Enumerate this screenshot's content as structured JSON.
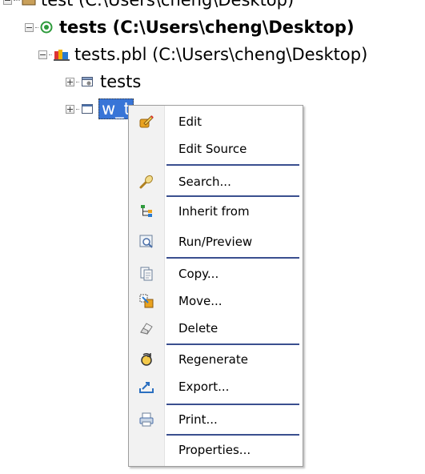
{
  "tree": {
    "workspace_label": "test (C:\\Users\\cheng\\Desktop)",
    "target_label": "tests (C:\\Users\\cheng\\Desktop)",
    "library_label": "tests.pbl (C:\\Users\\cheng\\Desktop)",
    "app_object_label": "tests",
    "window_object_label": "w_t"
  },
  "context_menu": {
    "items": [
      {
        "label": "Edit",
        "icon": "edit-pencil-icon"
      },
      {
        "label": "Edit Source",
        "icon": ""
      },
      {
        "label": "Search...",
        "icon": "search-icon"
      },
      {
        "label": "Inherit from",
        "icon": "inherit-tree-icon"
      },
      {
        "label": "Run/Preview",
        "icon": "run-preview-icon"
      },
      {
        "label": "Copy...",
        "icon": "copy-icon"
      },
      {
        "label": "Move...",
        "icon": "move-icon"
      },
      {
        "label": "Delete",
        "icon": "eraser-icon"
      },
      {
        "label": "Regenerate",
        "icon": "regenerate-icon"
      },
      {
        "label": "Export...",
        "icon": "export-icon"
      },
      {
        "label": "Print...",
        "icon": "print-icon"
      },
      {
        "label": "Properties...",
        "icon": ""
      }
    ]
  },
  "colors": {
    "selection": "#3875d7",
    "separator": "#3a4f8f",
    "gutter": "#f2f2f2"
  }
}
